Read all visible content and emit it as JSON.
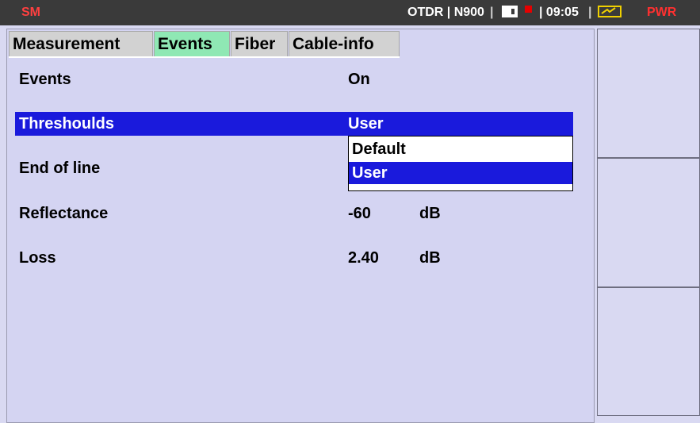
{
  "statusbar": {
    "mode": "SM",
    "title": "OTDR | N900",
    "separator1": "|",
    "time": "| 09:05",
    "separator2": "|",
    "power": "PWR",
    "icons": [
      "sd-card-icon",
      "record-indicator-icon",
      "battery-charging-icon"
    ]
  },
  "tabs": [
    {
      "label": "Measurement",
      "active": false
    },
    {
      "label": "Events",
      "active": true
    },
    {
      "label": "Fiber",
      "active": false
    },
    {
      "label": "Cable-info",
      "active": false
    }
  ],
  "settings": {
    "events": {
      "label": "Events",
      "value": "On"
    },
    "thresholds": {
      "label": "Threshoulds",
      "value": "User"
    },
    "end_of_line": {
      "label": "End of line"
    },
    "reflectance": {
      "label": "Reflectance",
      "value": "-60",
      "unit": "dB"
    },
    "loss": {
      "label": "Loss",
      "value": "2.40",
      "unit": "dB"
    }
  },
  "dropdown": {
    "options": [
      "Default",
      "User"
    ],
    "selected": "User"
  },
  "colors": {
    "background": "#d9d9f2",
    "highlight": "#1a1adc",
    "active_tab": "#8fe8b4",
    "statusbar": "#3a3a3a",
    "alert_red": "#ff3030"
  }
}
